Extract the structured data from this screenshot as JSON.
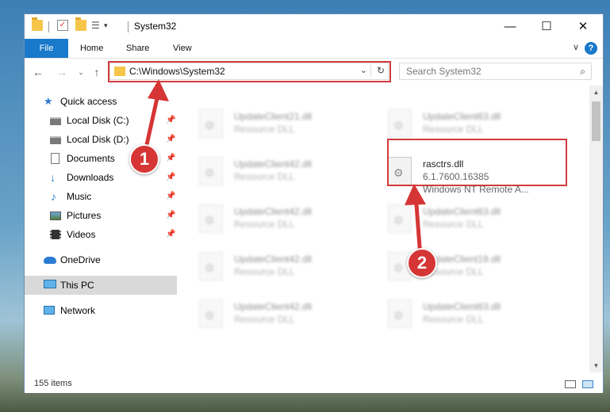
{
  "window": {
    "title": "System32",
    "minimize": "—",
    "maximize": "☐",
    "close": "✕"
  },
  "ribbon": {
    "tabs": [
      "File",
      "Home",
      "Share",
      "View"
    ],
    "expand": "∨",
    "help": "?"
  },
  "address": {
    "path": "C:\\Windows\\System32",
    "dropdown": "⌄",
    "refresh": "↻"
  },
  "search": {
    "placeholder": "Search System32"
  },
  "nav": {
    "items": [
      {
        "label": "Quick access",
        "icon": "star-icon",
        "pinned": false
      },
      {
        "label": "Local Disk (C:)",
        "icon": "drive-icon",
        "pinned": true
      },
      {
        "label": "Local Disk (D:)",
        "icon": "drive-icon",
        "pinned": true
      },
      {
        "label": "Documents",
        "icon": "documents-icon",
        "pinned": true
      },
      {
        "label": "Downloads",
        "icon": "download-icon",
        "pinned": true
      },
      {
        "label": "Music",
        "icon": "music-icon",
        "pinned": true
      },
      {
        "label": "Pictures",
        "icon": "pictures-icon",
        "pinned": true
      },
      {
        "label": "Videos",
        "icon": "videos-icon",
        "pinned": true
      },
      {
        "label": "OneDrive",
        "icon": "cloud-icon",
        "pinned": false
      },
      {
        "label": "This PC",
        "icon": "computer-icon",
        "pinned": false,
        "selected": true
      },
      {
        "label": "Network",
        "icon": "network-icon",
        "pinned": false
      }
    ],
    "pin_glyph": "📌"
  },
  "files": [
    {
      "name": "UpdateClient21.dll",
      "type": "Resource DLL"
    },
    {
      "name": "UpdateClient63.dll",
      "type": "Resource DLL"
    },
    {
      "name": "UpdateClient42.dll",
      "type": "Resource DLL"
    },
    {
      "name": "rasctrs.dll",
      "version": "6.1.7600.16385",
      "description": "Windows NT Remote A...",
      "highlighted": true
    },
    {
      "name": "UpdateClient42.dll",
      "type": "Resource DLL"
    },
    {
      "name": "UpdateClient63.dll",
      "type": "Resource DLL"
    },
    {
      "name": "UpdateClient42.dll",
      "type": "Resource DLL"
    },
    {
      "name": "UpdateClient19.dll",
      "type": "Resource DLL"
    },
    {
      "name": "UpdateClient42.dll",
      "type": "Resource DLL"
    },
    {
      "name": "UpdateClient63.dll",
      "type": "Resource DLL"
    }
  ],
  "status": {
    "items_count": "155 items"
  },
  "annotations": [
    "1",
    "2"
  ],
  "colors": {
    "accent": "#1979ca",
    "highlight": "#d23b3b",
    "badge": "#d63535"
  }
}
